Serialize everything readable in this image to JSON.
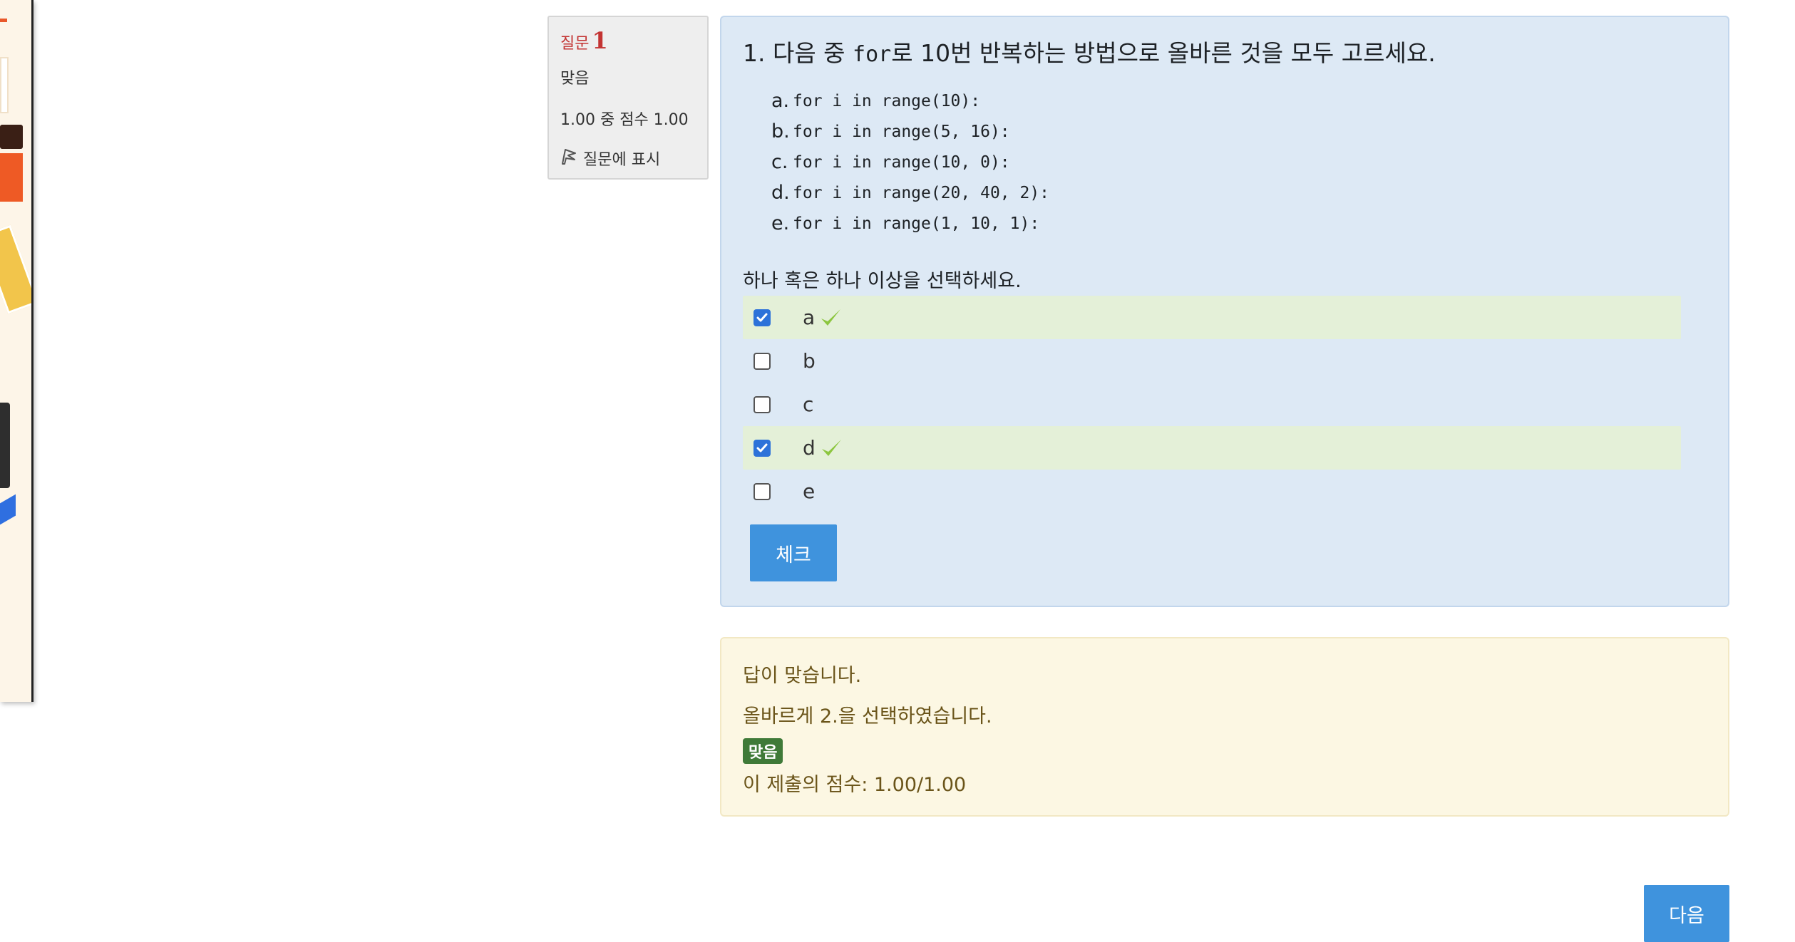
{
  "info": {
    "question_label": "질문",
    "question_number": "1",
    "state": "맞음",
    "grade": "1.00 중 점수 1.00",
    "flag_label": "질문에 표시"
  },
  "question": {
    "prefix": "1. 다음 중 ",
    "keyword": "for",
    "suffix": "로 10번 반복하는 방법으로 올바른 것을 모두 고르세요.",
    "options": [
      {
        "letter": "a.",
        "code": "for i in range(10):"
      },
      {
        "letter": "b.",
        "code": "for i in range(5, 16):"
      },
      {
        "letter": "c.",
        "code": "for i in range(10, 0):"
      },
      {
        "letter": "d.",
        "code": "for i in range(20, 40, 2):"
      },
      {
        "letter": "e.",
        "code": "for i in range(1, 10, 1):"
      }
    ],
    "prompt": "하나 혹은 하나 이상을 선택하세요.",
    "answers": [
      {
        "label": "a",
        "checked": true,
        "correct": true
      },
      {
        "label": "b",
        "checked": false,
        "correct": false
      },
      {
        "label": "c",
        "checked": false,
        "correct": false
      },
      {
        "label": "d",
        "checked": true,
        "correct": true
      },
      {
        "label": "e",
        "checked": false,
        "correct": false
      }
    ],
    "check_button": "체크"
  },
  "feedback": {
    "line1": "답이 맞습니다.",
    "line2": "올바르게 2.을 선택하였습니다.",
    "badge": "맞음",
    "score": "이 제출의 점수: 1.00/1.00"
  },
  "navigation": {
    "next_button": "다음"
  },
  "colors": {
    "accent_blue": "#3f93dd",
    "correct_green": "#3f7a38",
    "tick_green": "#8cc63f",
    "question_bg": "#dde9f5",
    "feedback_bg": "#fcf7e3"
  }
}
